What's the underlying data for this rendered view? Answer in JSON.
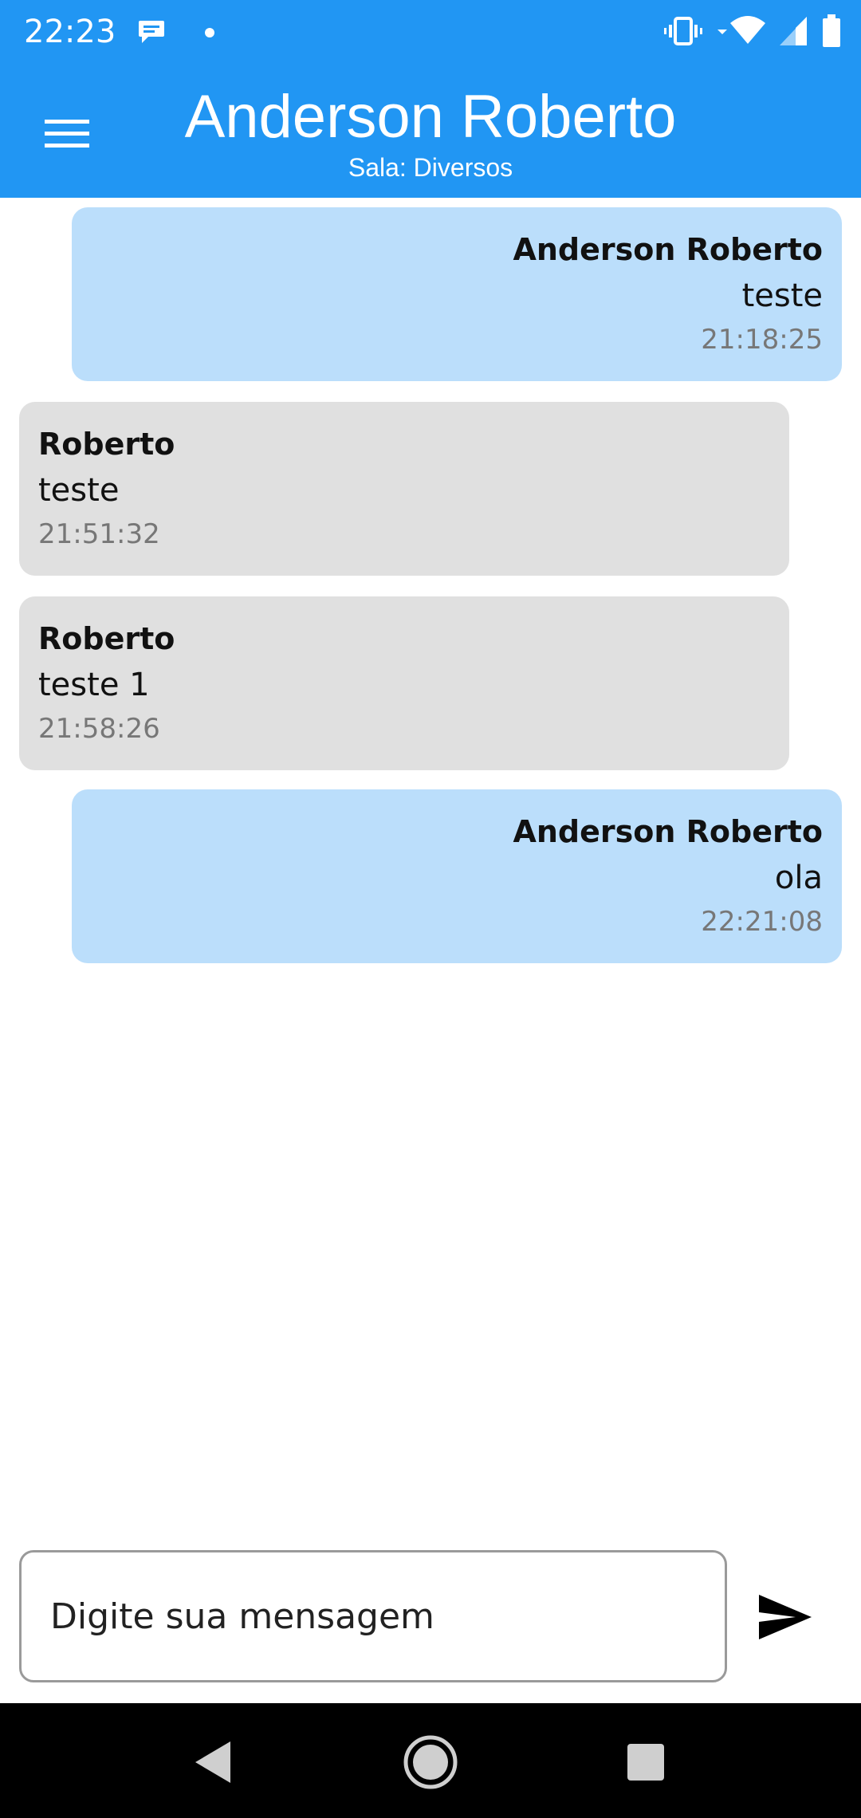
{
  "status_bar": {
    "time": "22:23",
    "icons": [
      "chat-bubble-icon",
      "dot-icon",
      "vibrate-icon",
      "wifi-icon",
      "signal-icon",
      "battery-icon"
    ]
  },
  "app_bar": {
    "title": "Anderson Roberto",
    "subtitle": "Sala: Diversos",
    "menu_icon": "menu-icon"
  },
  "messages": [
    {
      "direction": "out",
      "author": "Anderson Roberto",
      "text": "teste",
      "time": "21:18:25"
    },
    {
      "direction": "in",
      "author": "Roberto",
      "text": "teste",
      "time": "21:51:32"
    },
    {
      "direction": "in",
      "author": "Roberto",
      "text": "teste 1",
      "time": "21:58:26"
    },
    {
      "direction": "out",
      "author": "Anderson Roberto",
      "text": "ola",
      "time": "22:21:08"
    }
  ],
  "composer": {
    "placeholder": "Digite sua mensagem",
    "value": "",
    "send_icon": "send-icon"
  },
  "nav_bar": {
    "icons": [
      "back-icon",
      "home-icon",
      "recents-icon"
    ]
  },
  "colors": {
    "primary": "#2196F3",
    "outgoing_bubble": "#BBDEFB",
    "incoming_bubble": "#E0E0E0"
  }
}
